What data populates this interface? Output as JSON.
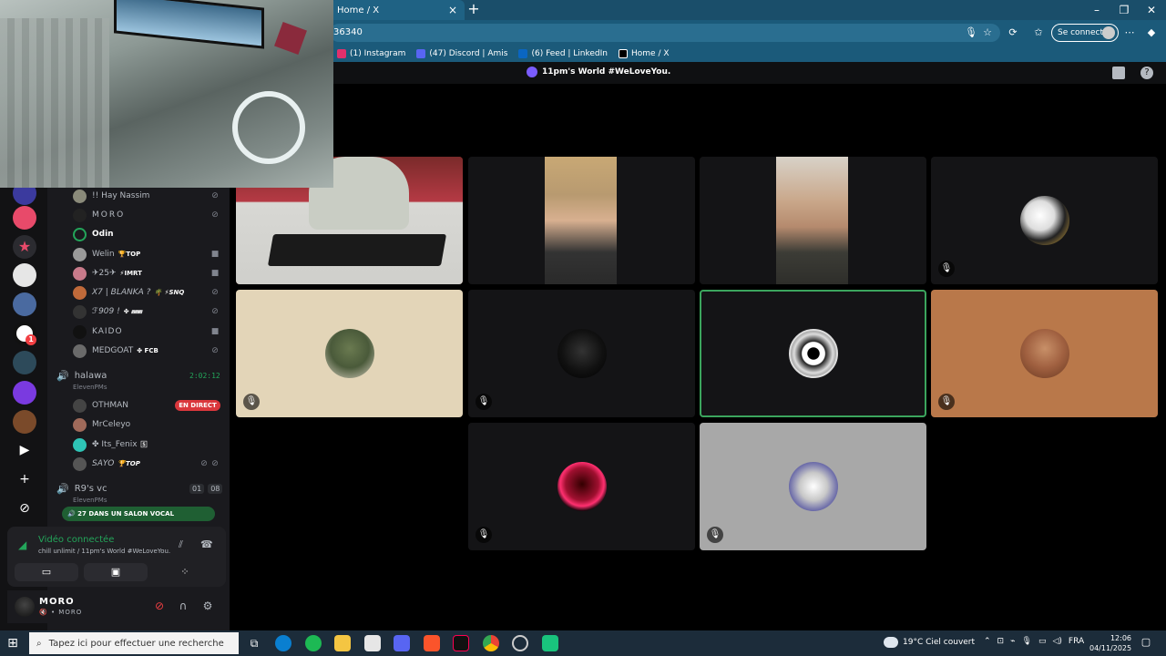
{
  "browser": {
    "tab_title": "Home / X",
    "tab_close": "×",
    "new_tab": "+",
    "address": "36340",
    "signin_label": "Se connecter",
    "window_controls": [
      "–",
      "❐",
      "✕"
    ],
    "bookmarks": [
      {
        "label": "(1) Instagram",
        "icon": "instagram-icon",
        "color": "#e1306c"
      },
      {
        "label": "(47) Discord | Amis",
        "icon": "discord-icon",
        "color": "#5865f2"
      },
      {
        "label": "(6) Feed | LinkedIn",
        "icon": "linkedin-icon",
        "color": "#0a66c2"
      },
      {
        "label": "Home / X",
        "icon": "x-icon",
        "color": "#000000"
      }
    ]
  },
  "discord": {
    "channel_title": "11pm's World #WeLoveYou.",
    "members": [
      {
        "name": "!! Hay Nassim",
        "tag": "",
        "status": "mic-off"
      },
      {
        "name": "MORO",
        "tag": "",
        "status": "mic-off"
      },
      {
        "name": "Odin",
        "tag": "",
        "status": ""
      },
      {
        "name": "Welin",
        "tag": "🏆TOP",
        "status": "camera"
      },
      {
        "name": "✈25✈",
        "tag": "⚡IMRT",
        "status": "camera"
      },
      {
        "name": "X7 | BLANKA ?",
        "tag": "🌴 ⚡SNQ",
        "status": "mic-off"
      },
      {
        "name": "ℱ909 !",
        "tag": "✤ ⩎⩎⩎",
        "status": "mic-off"
      },
      {
        "name": "KAIDO",
        "tag": "",
        "status": "camera"
      },
      {
        "name": "MEDGOAT",
        "tag": "✤ FCB",
        "status": "mic-off"
      }
    ],
    "channel_halawa": {
      "name": "halawa",
      "sub": "ElevenPMs",
      "time": "2:02:12"
    },
    "halawa_members": [
      {
        "name": "OTHMAN",
        "tag": ""
      },
      {
        "name": "MrCeleyo",
        "tag": ""
      },
      {
        "name": "✤ Its_Fenix",
        "tag": "🅂"
      },
      {
        "name": "SAYO",
        "tag": "🏆TOP"
      }
    ],
    "live_label": "EN DIRECT",
    "channel_r9": {
      "name": "R9's vc",
      "sub": "ElevenPMs",
      "count_a": "01",
      "count_b": "08"
    },
    "voice_pill": "🔊 27 DANS UN SALON VOCAL",
    "voice_panel": {
      "title": "Vidéo connectée",
      "subtitle": "chill unlimit / 11pm's World #WeLoveYou."
    },
    "user": {
      "name": "MORO",
      "status": "🔇 • MORO"
    }
  },
  "taskbar": {
    "search_placeholder": "Tapez ici pour effectuer une recherche",
    "weather": "19°C  Ciel couvert",
    "lang": "FRA",
    "time": "12:06",
    "date": "04/11/2025"
  }
}
